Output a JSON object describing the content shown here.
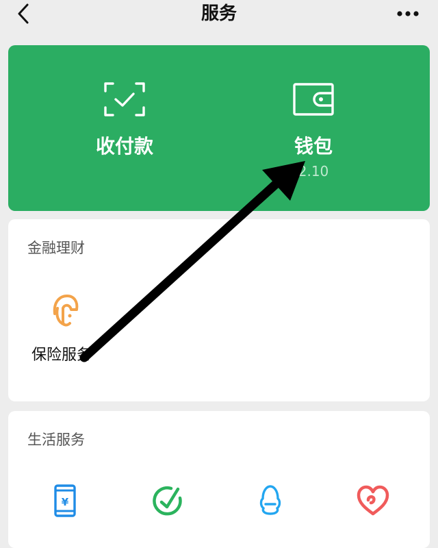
{
  "header": {
    "title": "服务",
    "back_icon": "chevron-left-icon",
    "more_icon": "more-dots-icon"
  },
  "top_card": {
    "color": "#2bad62",
    "pay": {
      "label": "收付款",
      "icon": "scan-check-icon"
    },
    "wallet": {
      "label": "钱包",
      "balance": "2.10",
      "icon": "wallet-icon"
    }
  },
  "finance": {
    "title": "金融理财",
    "items": [
      {
        "label": "保险服务",
        "icon": "insurance-umbrella-icon",
        "color": "#f3a34a"
      }
    ]
  },
  "life": {
    "title": "生活服务",
    "items": [
      {
        "icon": "mobile-topup-icon",
        "color": "#1f8ce6"
      },
      {
        "icon": "green-check-icon",
        "color": "#2bb35d"
      },
      {
        "icon": "qq-penguin-icon",
        "color": "#23a6f0"
      },
      {
        "icon": "charity-heart-icon",
        "color": "#f05b5b"
      }
    ]
  },
  "annotation": {
    "type": "arrow",
    "color": "#000000"
  }
}
